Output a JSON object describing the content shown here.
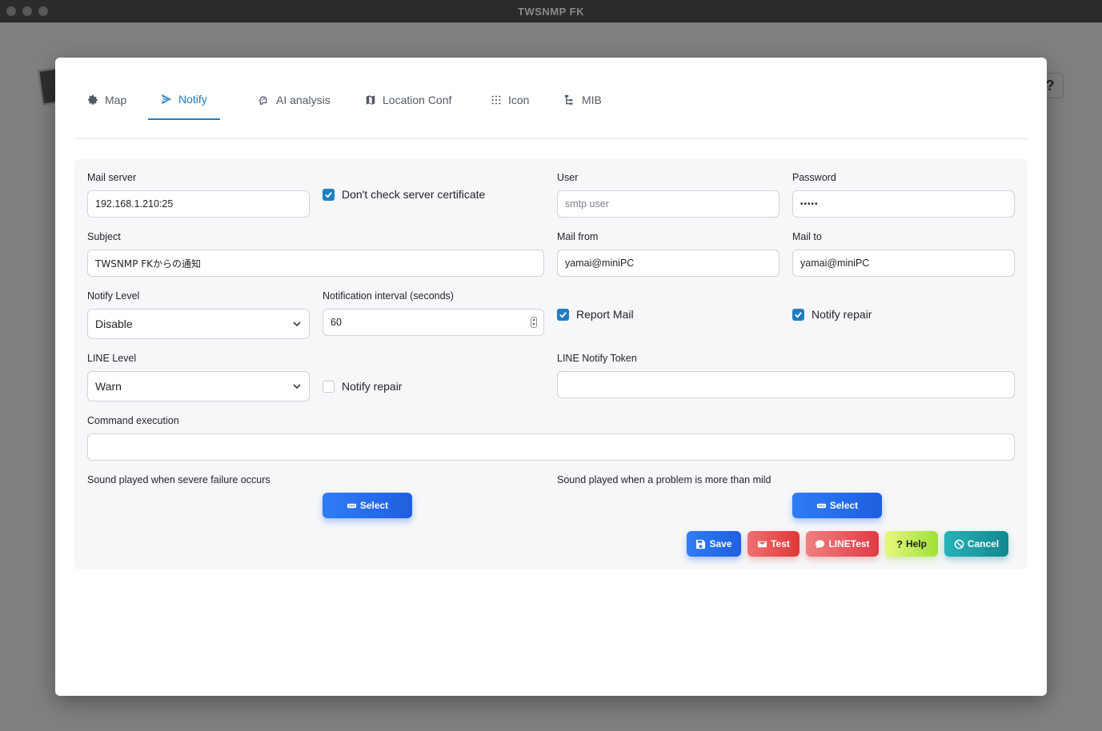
{
  "window": {
    "title": "TWSNMP FK"
  },
  "tabs": [
    {
      "label": "Map",
      "icon": "gear-icon"
    },
    {
      "label": "Notify",
      "icon": "send-icon",
      "active": true
    },
    {
      "label": "AI analysis",
      "icon": "brain-icon"
    },
    {
      "label": "Location Conf",
      "icon": "map-icon"
    },
    {
      "label": "Icon",
      "icon": "grid-dots-icon"
    },
    {
      "label": "MIB",
      "icon": "tree-icon"
    }
  ],
  "form": {
    "mail_server": {
      "label": "Mail server",
      "value": "192.168.1.210:25"
    },
    "insecure": {
      "label": "Don't check server certificate",
      "checked": true
    },
    "user": {
      "label": "User",
      "placeholder": "smtp user"
    },
    "password": {
      "label": "Password",
      "value": "•••••"
    },
    "subject": {
      "label": "Subject",
      "value": "TWSNMP FKからの通知"
    },
    "mail_from": {
      "label": "Mail from",
      "value": "yamai@miniPC"
    },
    "mail_to": {
      "label": "Mail to",
      "value": "yamai@miniPC"
    },
    "notify_level": {
      "label": "Notify Level",
      "value": "Disable"
    },
    "interval": {
      "label": "Notification interval (seconds)",
      "value": "60"
    },
    "report_mail": {
      "label": "Report Mail",
      "checked": true
    },
    "notify_repair": {
      "label": "Notify repair",
      "checked": true
    },
    "line_level": {
      "label": "LINE Level",
      "value": "Warn"
    },
    "line_notify_repair": {
      "label": "Notify repair",
      "checked": false
    },
    "line_token": {
      "label": "LINE Notify Token",
      "value": ""
    },
    "command": {
      "label": "Command execution",
      "value": ""
    },
    "sound_high": {
      "label": "Sound played when severe failure occurs",
      "button": "Select"
    },
    "sound_low": {
      "label": "Sound played when a problem is more than mild",
      "button": "Select"
    }
  },
  "actions": {
    "save": "Save",
    "test": "Test",
    "linetest": "LINETest",
    "help": "Help",
    "cancel": "Cancel"
  },
  "colors": {
    "accent": "#1e7fc2",
    "save": "#2f7df5",
    "test": "#e03838",
    "help": "#9fe03a",
    "cancel": "#11888f"
  }
}
